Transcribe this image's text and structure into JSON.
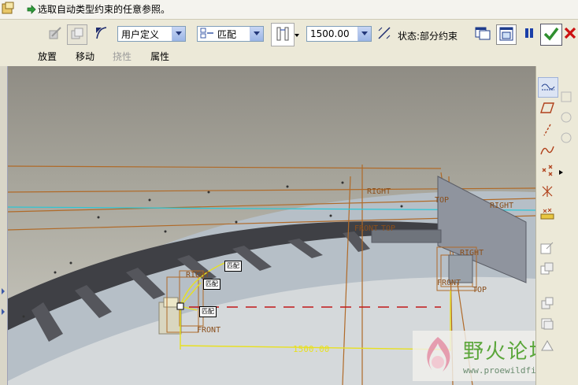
{
  "dashboard": {
    "prompt": "选取自动类型约束的任意参照。",
    "placement_combo": {
      "selected": "用户定义"
    },
    "constraint_combo": {
      "selected": "匹配"
    },
    "offset_combo": {
      "selected": "1500.00"
    },
    "status": "状态:部分约束",
    "tabs": [
      {
        "label": "放置",
        "enabled": true
      },
      {
        "label": "移动",
        "enabled": true
      },
      {
        "label": "挠性",
        "enabled": false
      },
      {
        "label": "属性",
        "enabled": true
      }
    ],
    "colors": {
      "accept": "#2f8f2f",
      "cancel": "#cc1111",
      "pause": "#1a3fa8"
    }
  },
  "viewport": {
    "datum_labels": {
      "right_1": "RIGHT",
      "right_2": "RIGHT",
      "right_3": "RIGHT",
      "right_4": "RIGHT",
      "top_1": "TOP",
      "top_2": "TOP",
      "top_3": "TOP",
      "front_1": "FRONT",
      "front_2": "FRONT",
      "front_3": "FRONT"
    },
    "tags": {
      "match_1": "匹配",
      "match_2": "匹配",
      "match_3": "匹配"
    },
    "dimension": "1500.00"
  },
  "watermark": {
    "title": "野火论坛",
    "url": "www.proewildfire.cn"
  }
}
